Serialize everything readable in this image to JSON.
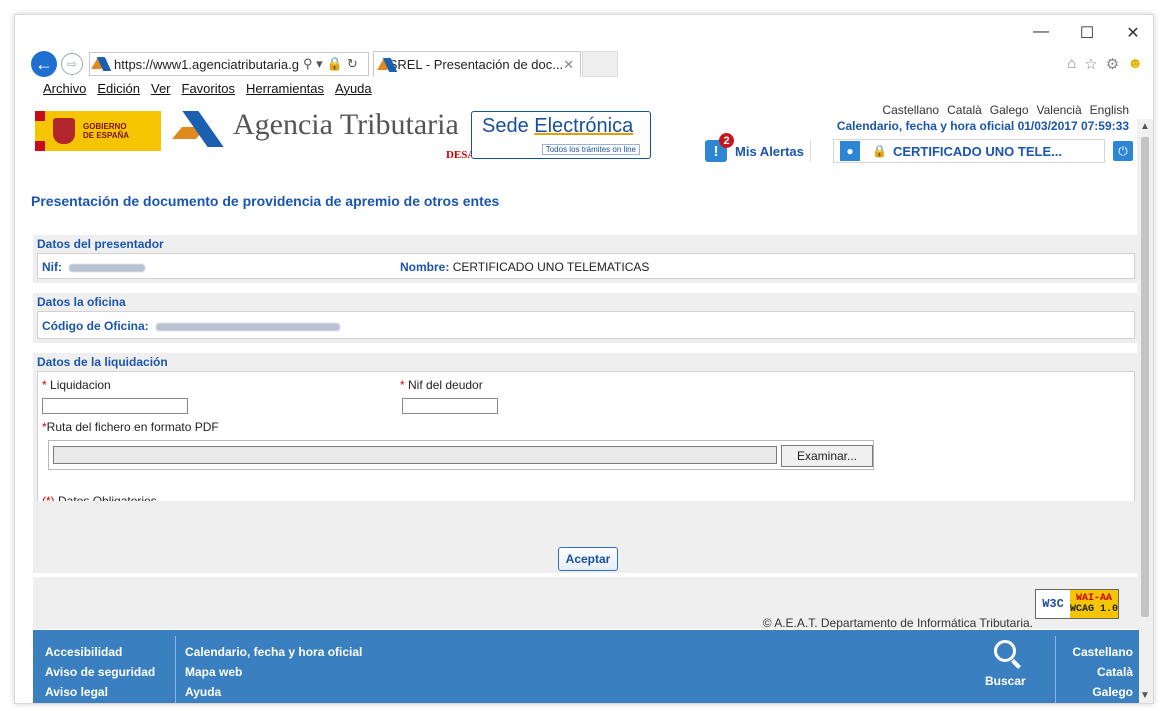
{
  "browser": {
    "url": "https://www1.agenciatributaria.g",
    "tab_title": "SREL - Presentación de doc...",
    "menu": [
      "Archivo",
      "Edición",
      "Ver",
      "Favoritos",
      "Herramientas",
      "Ayuda"
    ]
  },
  "header": {
    "gobierno_line1": "GOBIERNO",
    "gobierno_line2": "DE ESPAÑA",
    "agency_name": "Agencia Tributaria",
    "environment": "DESARROLLO",
    "sede_title_1": "Sede ",
    "sede_title_2": "Electrónica",
    "sede_subtitle": "Todos los trámites on line",
    "languages": [
      "Castellano",
      "Català",
      "Galego",
      "Valencià",
      "English"
    ],
    "calendar": "Calendario, fecha y hora oficial 01/03/2017 07:59:33",
    "alerts_count": "2",
    "alerts_label": "Mis Alertas",
    "certificate_label": "CERTIFICADO UNO TELE..."
  },
  "page": {
    "title": "Presentación de documento de providencia de apremio de otros entes",
    "presentador": {
      "header": "Datos del presentador",
      "nif_label": "Nif:",
      "nombre_label": "Nombre:",
      "nombre_value": "CERTIFICADO UNO TELEMATICAS"
    },
    "oficina": {
      "header": "Datos la oficina",
      "codigo_label": "Código de Oficina:"
    },
    "liquidacion": {
      "header": "Datos de la liquidación",
      "liquidacion_label": "Liquidacion",
      "nif_deudor_label": "Nif del deudor",
      "ruta_label": "Ruta del fichero en formato PDF",
      "examinar_label": "Examinar...",
      "liquidacion_value": "",
      "nif_deudor_value": "",
      "ruta_value": ""
    },
    "required_star": "(*)",
    "required_note": " Datos Obligatorios",
    "accept_label": "Aceptar"
  },
  "footer": {
    "copyright": "© A.E.A.T. Departamento de Informática Tributaria.",
    "wai_w3c": "W3C",
    "wai_level": "WAI-AA",
    "wai_wcag": "WCAG 1.0",
    "col1": [
      "Accesibilidad",
      "Aviso de seguridad",
      "Aviso legal"
    ],
    "col2": [
      "Calendario, fecha y hora oficial",
      "Mapa web",
      "Ayuda"
    ],
    "search_label": "Buscar",
    "languages": [
      "Castellano",
      "Català",
      "Galego"
    ]
  }
}
